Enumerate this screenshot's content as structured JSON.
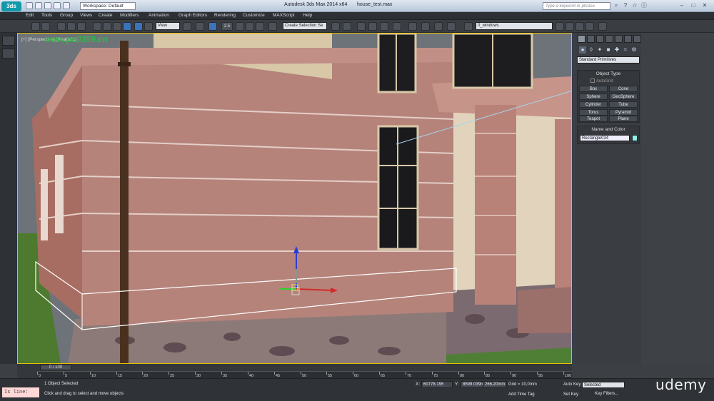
{
  "title": {
    "workspace": "Workspace: Default",
    "app": "Autodesk 3ds Max  2014 x64",
    "file": "house_test.max",
    "search_placeholder": "Type a keyword or phrase"
  },
  "menu": [
    "Edit",
    "Tools",
    "Group",
    "Views",
    "Create",
    "Modifiers",
    "Animation",
    "Graph Editors",
    "Rendering",
    "Customize",
    "MAXScript",
    "Help"
  ],
  "toolbar": {
    "reference": "View",
    "selection_set": "Create Selection Se",
    "layer": "0_windows",
    "snap": "2.5"
  },
  "viewport": {
    "label": "[+] [Perspective] [Realistic]",
    "watermark": "www.pc0359.cn"
  },
  "panel": {
    "category": "Standard Primitives",
    "object_type_header": "Object Type",
    "autogrid": "AutoGrid",
    "buttons": [
      "Box",
      "Cone",
      "Sphere",
      "GeoSphere",
      "Cylinder",
      "Tube",
      "Torus",
      "Pyramid",
      "Teapot",
      "Plane"
    ],
    "name_color_header": "Name and Color",
    "object_name": "Rectangle034",
    "object_color": "#8cf0e8"
  },
  "timeline": {
    "position": "0 / 100",
    "ticks": [
      "0",
      "5",
      "10",
      "15",
      "20",
      "25",
      "30",
      "35",
      "40",
      "45",
      "50",
      "55",
      "60",
      "65",
      "70",
      "75",
      "80",
      "85",
      "90",
      "95",
      "100"
    ]
  },
  "status": {
    "maxscript": "Is line:",
    "selection": "1 Object Selected",
    "prompt": "Click and drag to select and move objects",
    "x_label": "X:",
    "x": "60778.195",
    "y_label": "Y:",
    "y": "8599.039n",
    "z_label": "Z:",
    "z": "266,20mm",
    "grid": "Grid = 10,0mm",
    "add_time_tag": "Add Time Tag",
    "auto_key": "Auto Key",
    "key_mode": "Selected",
    "set_key": "Set Key",
    "key_filters": "Key Filters...",
    "brand": "udemy"
  }
}
